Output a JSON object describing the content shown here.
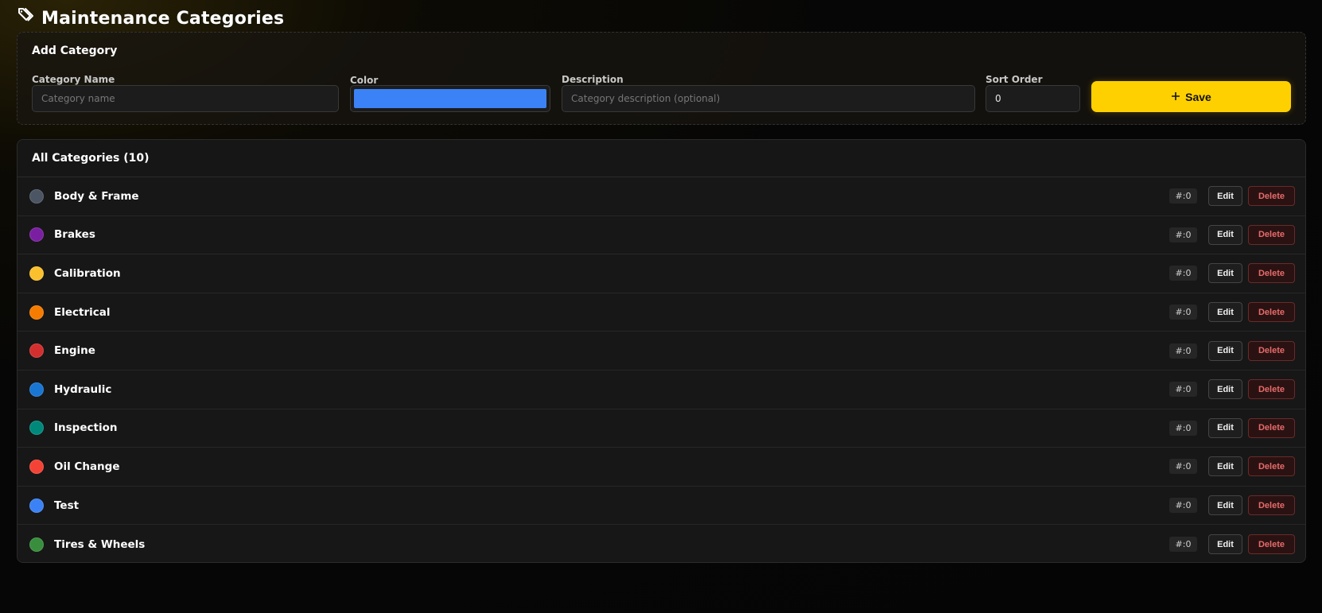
{
  "page": {
    "title": "Maintenance Categories",
    "title_icon": "tag-icon"
  },
  "add_form": {
    "title": "Add Category",
    "name_label": "Category Name",
    "name_placeholder": "Category name",
    "name_value": "",
    "color_label": "Color",
    "color_value": "#3b82f6",
    "description_label": "Description",
    "description_placeholder": "Category description (optional)",
    "description_value": "",
    "sort_label": "Sort Order",
    "sort_value": "0",
    "save_icon": "plus-icon",
    "save_label": "Save",
    "accent": "#ffd000"
  },
  "list": {
    "header": "All Categories (10)",
    "edit_label": "Edit",
    "delete_label": "Delete",
    "items": [
      {
        "name": "Body & Frame",
        "color": "#4b5563",
        "sort": "#:0"
      },
      {
        "name": "Brakes",
        "color": "#7b1fa2",
        "sort": "#:0"
      },
      {
        "name": "Calibration",
        "color": "#fbc02d",
        "sort": "#:0"
      },
      {
        "name": "Electrical",
        "color": "#f57c00",
        "sort": "#:0"
      },
      {
        "name": "Engine",
        "color": "#d32f2f",
        "sort": "#:0"
      },
      {
        "name": "Hydraulic",
        "color": "#1976d2",
        "sort": "#:0"
      },
      {
        "name": "Inspection",
        "color": "#00897b",
        "sort": "#:0"
      },
      {
        "name": "Oil Change",
        "color": "#f44336",
        "sort": "#:0"
      },
      {
        "name": "Test",
        "color": "#3b82f6",
        "sort": "#:0"
      },
      {
        "name": "Tires & Wheels",
        "color": "#388e3c",
        "sort": "#:0"
      }
    ]
  }
}
